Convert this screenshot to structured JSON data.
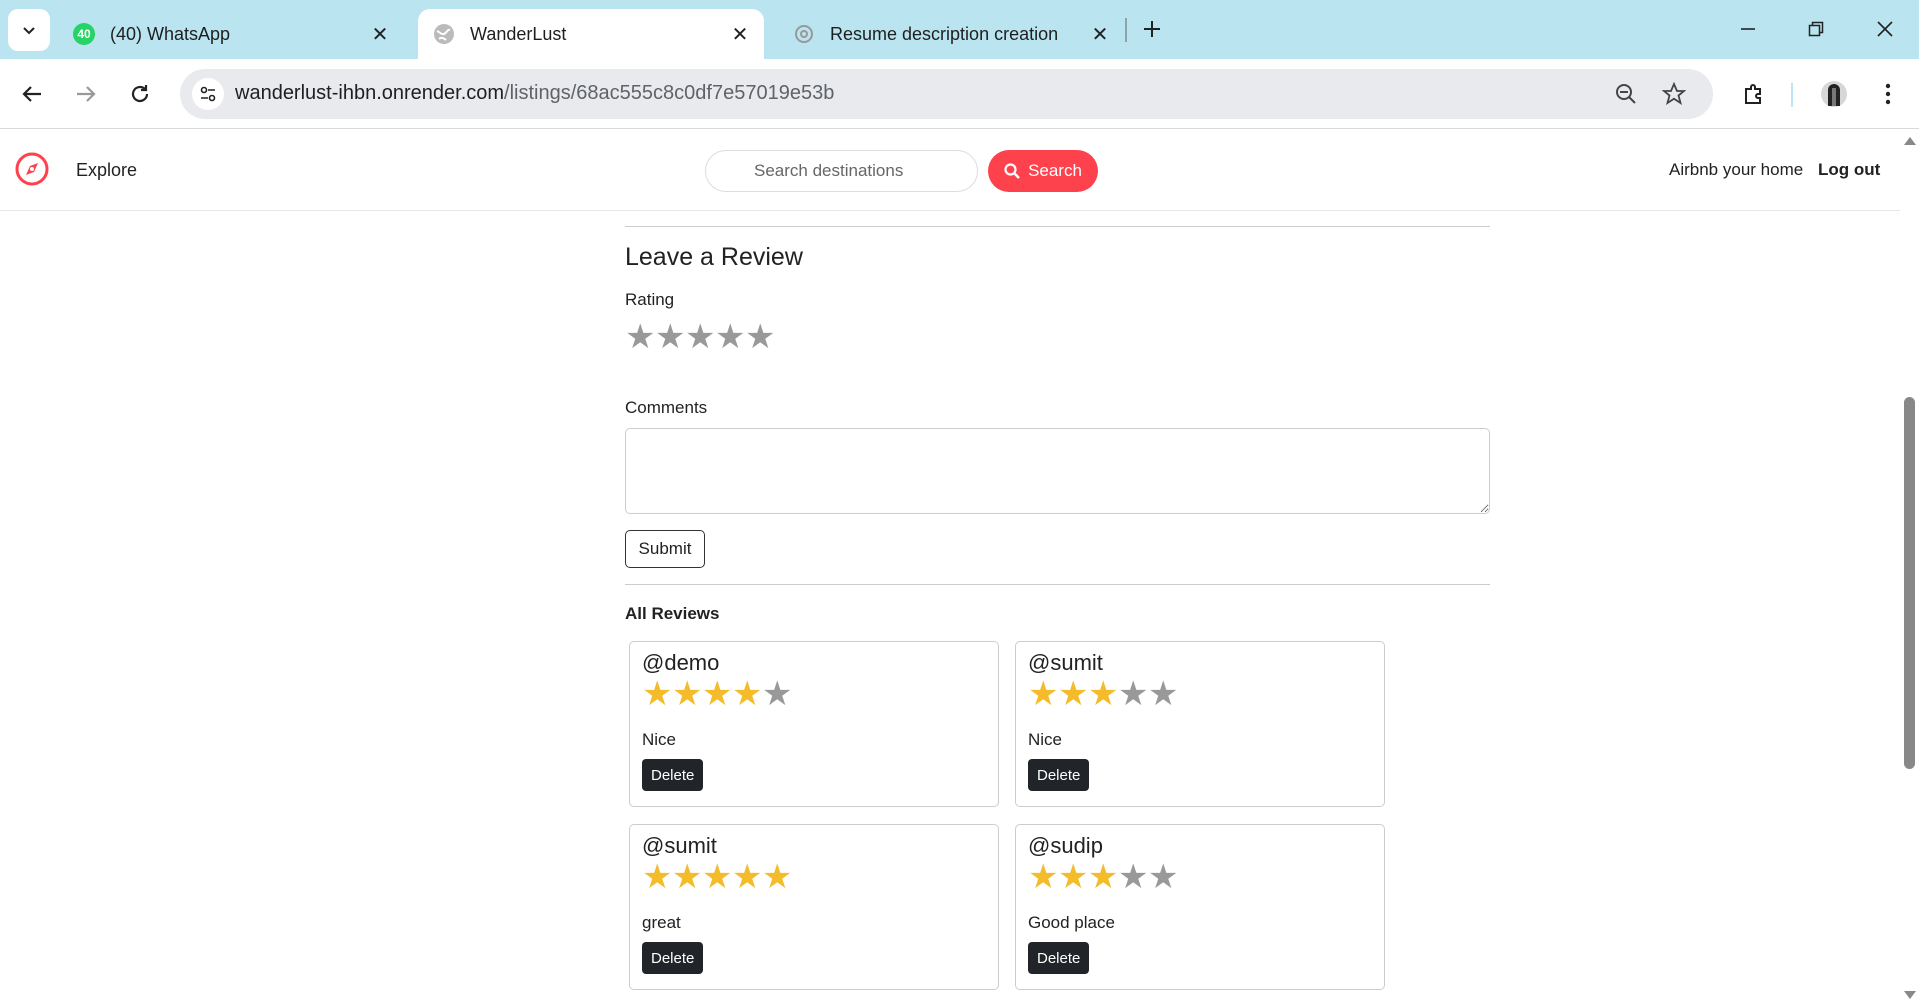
{
  "browser": {
    "tabs": [
      {
        "title": "(40) WhatsApp",
        "badge": "40",
        "active": false
      },
      {
        "title": "WanderLust",
        "active": true
      },
      {
        "title": "Resume description creation",
        "active": false
      }
    ],
    "url_host": "wanderlust-ihbn.onrender.com",
    "url_path": "/listings/68ac555c8c0df7e57019e53b"
  },
  "site": {
    "nav": {
      "explore": "Explore",
      "search_placeholder": "Search destinations",
      "search_button": "Search",
      "host_link": "Airbnb your home",
      "logout": "Log out"
    },
    "brand_color": "#fe424d"
  },
  "review_form": {
    "title": "Leave a Review",
    "rating_label": "Rating",
    "rating_value": 0,
    "rating_max": 5,
    "comments_label": "Comments",
    "comments_value": "",
    "submit_label": "Submit"
  },
  "reviews": {
    "heading": "All Reviews",
    "delete_label": "Delete",
    "star_color": "#f4bc2a",
    "items": [
      {
        "author": "@demo",
        "rating": 4,
        "comment": "Nice"
      },
      {
        "author": "@sumit",
        "rating": 3,
        "comment": "Nice"
      },
      {
        "author": "@sumit",
        "rating": 5,
        "comment": "great"
      },
      {
        "author": "@sudip",
        "rating": 3,
        "comment": "Good place"
      }
    ]
  }
}
